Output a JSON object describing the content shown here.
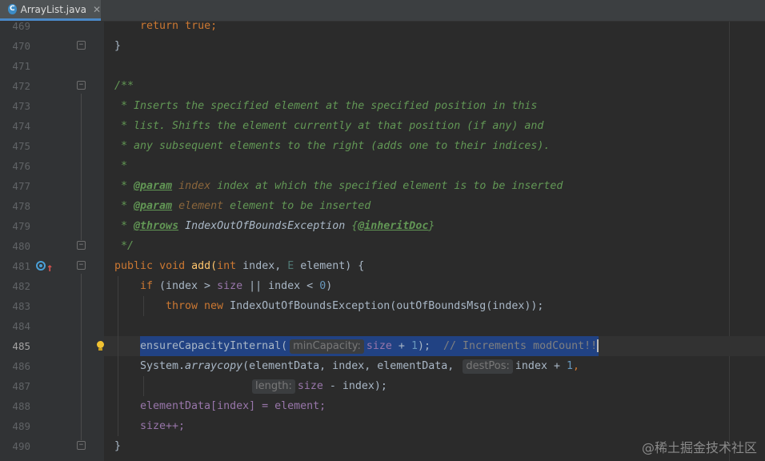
{
  "tab": {
    "icon_letter": "C",
    "file_name": "ArrayList.java",
    "close": "✕"
  },
  "editor": {
    "line_numbers": [
      "469",
      "470",
      "471",
      "472",
      "473",
      "474",
      "475",
      "476",
      "477",
      "478",
      "479",
      "480",
      "481",
      "482",
      "483",
      "484",
      "485",
      "486",
      "487",
      "488",
      "489",
      "490"
    ],
    "current_line": "485",
    "hints": {
      "min_capacity": "minCapacity:",
      "dest_pos": "destPos:",
      "length": "length:"
    }
  },
  "code": {
    "l469": {
      "kw": "return",
      "val": "true",
      ";": ";"
    },
    "l470": "}",
    "l472": "/**",
    "l473": " * Inserts the specified element at the specified position in this",
    "l474": " * list. Shifts the element currently at that position (if any) and",
    "l475": " * any subsequent elements to the right (adds one to their indices).",
    "l476": " *",
    "l477": {
      "star": " * ",
      "tag": "@param",
      "name": "index",
      "text": " index at which the specified element is to be inserted"
    },
    "l478": {
      "star": " * ",
      "tag": "@param",
      "name": "element",
      "text": " element to be inserted"
    },
    "l479": {
      "star": " * ",
      "tag": "@throws",
      "exc": "IndexOutOfBoundsException",
      "brace_open": "{",
      "inherit": "@inheritDoc",
      "brace_close": "}"
    },
    "l480": " */",
    "l481": {
      "public": "public",
      "void": "void",
      "method": "add(",
      "int": "int",
      "rest1": " index, ",
      "etype": "E",
      "rest2": " element) {"
    },
    "l482": {
      "if": "if",
      "p1": " (index > ",
      "size": "size",
      "p2": " || index < ",
      "zero": "0",
      ")": ")"
    },
    "l483": {
      "throw": "throw",
      "new": "new",
      "rest": " IndexOutOfBoundsException(outOfBoundsMsg(index));"
    },
    "l485": {
      "call": "ensureCapacityInternal(",
      "size": "size",
      "rest": " + ",
      "one": "1",
      "close": ");",
      "comment": "  // Increments modCount!!"
    },
    "l486": {
      "sys": "System.",
      "arraycopy": "arraycopy",
      "a": "(elementData, index, elementData,",
      "b": "index + ",
      "one": "1",
      ",": ","
    },
    "l487": {
      "size": "size",
      "rest": " - index);"
    },
    "l488": "elementData[index] = element;",
    "l489": "size++;",
    "l490": "}"
  },
  "watermark": "@稀土掘金技术社区"
}
